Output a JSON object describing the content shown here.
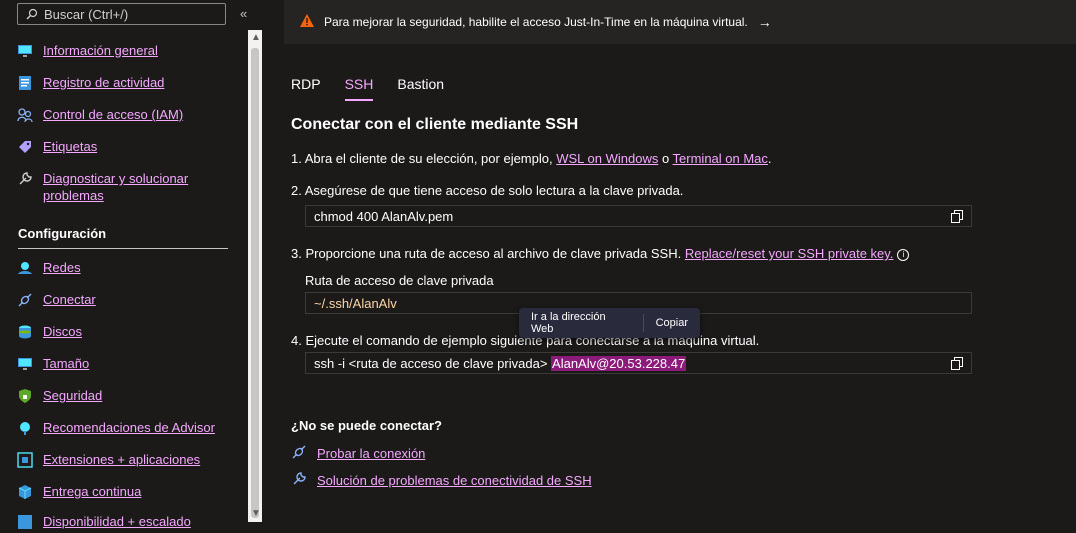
{
  "sidebar": {
    "search_placeholder": "Buscar (Ctrl+/)",
    "collapse_glyph": "«",
    "items_top": [
      {
        "label": "Información general",
        "icon": "monitor-icon"
      },
      {
        "label": "Registro de actividad",
        "icon": "activity-log-icon"
      },
      {
        "label": "Control de acceso (IAM)",
        "icon": "people-icon"
      },
      {
        "label": "Etiquetas",
        "icon": "tag-icon"
      },
      {
        "label": "Diagnosticar y solucionar problemas",
        "icon": "wrench-icon"
      }
    ],
    "section_title": "Configuración",
    "items_config": [
      {
        "label": "Redes",
        "icon": "network-icon"
      },
      {
        "label": "Conectar",
        "icon": "connect-icon"
      },
      {
        "label": "Discos",
        "icon": "disks-icon"
      },
      {
        "label": "Tamaño",
        "icon": "monitor-icon"
      },
      {
        "label": "Seguridad",
        "icon": "shield-icon"
      },
      {
        "label": "Recomendaciones de Advisor",
        "icon": "advisor-icon"
      },
      {
        "label": "Extensiones + aplicaciones",
        "icon": "extensions-icon"
      },
      {
        "label": "Entrega continua",
        "icon": "cube-icon"
      },
      {
        "label": "Disponibilidad + escalado",
        "icon": "availability-icon"
      }
    ]
  },
  "banner": {
    "text": "Para mejorar la seguridad, habilite el acceso Just-In-Time en la máquina virtual.",
    "arrow": "→"
  },
  "tabs": [
    "RDP",
    "SSH",
    "Bastion"
  ],
  "active_tab": "SSH",
  "heading": "Conectar con el cliente mediante SSH",
  "steps": {
    "s1_prefix": "1. Abra el cliente de su elección, por ejemplo, ",
    "s1_link1": "WSL on Windows",
    "s1_mid": " o ",
    "s1_link2": "Terminal on Mac",
    "s1_suffix": ".",
    "s2": "2. Asegúrese de que tiene acceso de solo lectura a la clave privada.",
    "s2_code": "chmod 400 AlanAlv.pem",
    "s3_prefix": "3. Proporcione una ruta de acceso al archivo de clave privada SSH. ",
    "s3_link": "Replace/reset your SSH private key.",
    "s3_info": "i",
    "path_label": "Ruta de acceso de clave privada",
    "path_value": "~/.ssh/AlanAlv",
    "s4": "4. Ejecute el comando de ejemplo siguiente para conectarse a la máquina virtual.",
    "s4_code_prefix": "ssh -i <ruta de acceso de clave privada> ",
    "s4_code_highlight": "AlanAlv@20.53.228.47"
  },
  "tooltip": {
    "go_web": "Ir a la dirección Web",
    "copy": "Copiar"
  },
  "help": {
    "title": "¿No se puede conectar?",
    "link1": "Probar la conexión",
    "link2": "Solución de problemas de conectividad de SSH"
  },
  "colors": {
    "link": "#f5a8ff",
    "highlight": "#8b1a7a",
    "warning": "#f7630c"
  }
}
